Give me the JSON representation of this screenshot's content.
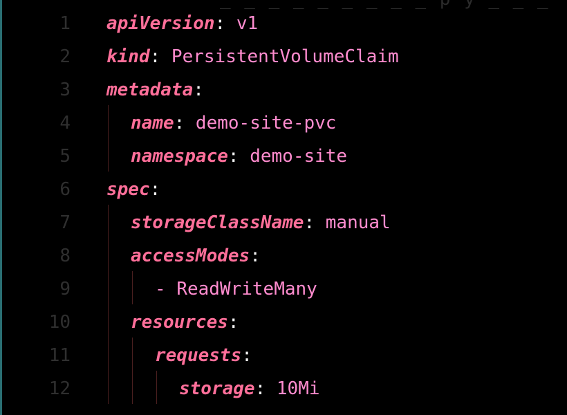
{
  "editor": {
    "lines": [
      {
        "number": "1",
        "key": "apiVersion",
        "separator": ":",
        "value": " v1"
      },
      {
        "number": "2",
        "key": "kind",
        "separator": ":",
        "value": " PersistentVolumeClaim"
      },
      {
        "number": "3",
        "key": "metadata",
        "separator": ":",
        "value": ""
      },
      {
        "number": "4",
        "key": "name",
        "separator": ":",
        "value": " demo-site-pvc"
      },
      {
        "number": "5",
        "key": "namespace",
        "separator": ":",
        "value": " demo-site"
      },
      {
        "number": "6",
        "key": "spec",
        "separator": ":",
        "value": ""
      },
      {
        "number": "7",
        "key": "storageClassName",
        "separator": ":",
        "value": " manual"
      },
      {
        "number": "8",
        "key": "accessModes",
        "separator": ":",
        "value": ""
      },
      {
        "number": "9",
        "dash": "- ",
        "value": "ReadWriteMany"
      },
      {
        "number": "10",
        "key": "resources",
        "separator": ":",
        "value": ""
      },
      {
        "number": "11",
        "key": "requests",
        "separator": ":",
        "value": ""
      },
      {
        "number": "12",
        "key": "storage",
        "separator": ":",
        "value": " 10Mi"
      }
    ]
  },
  "colors": {
    "background": "#000000",
    "key": "#ff6f9a",
    "value": "#ff8ccf",
    "punctuation": "#f2f2f2",
    "line_number": "#2f2f2f",
    "indent_guide": "#4a1f1f",
    "window_edge": "#2a6f73"
  }
}
